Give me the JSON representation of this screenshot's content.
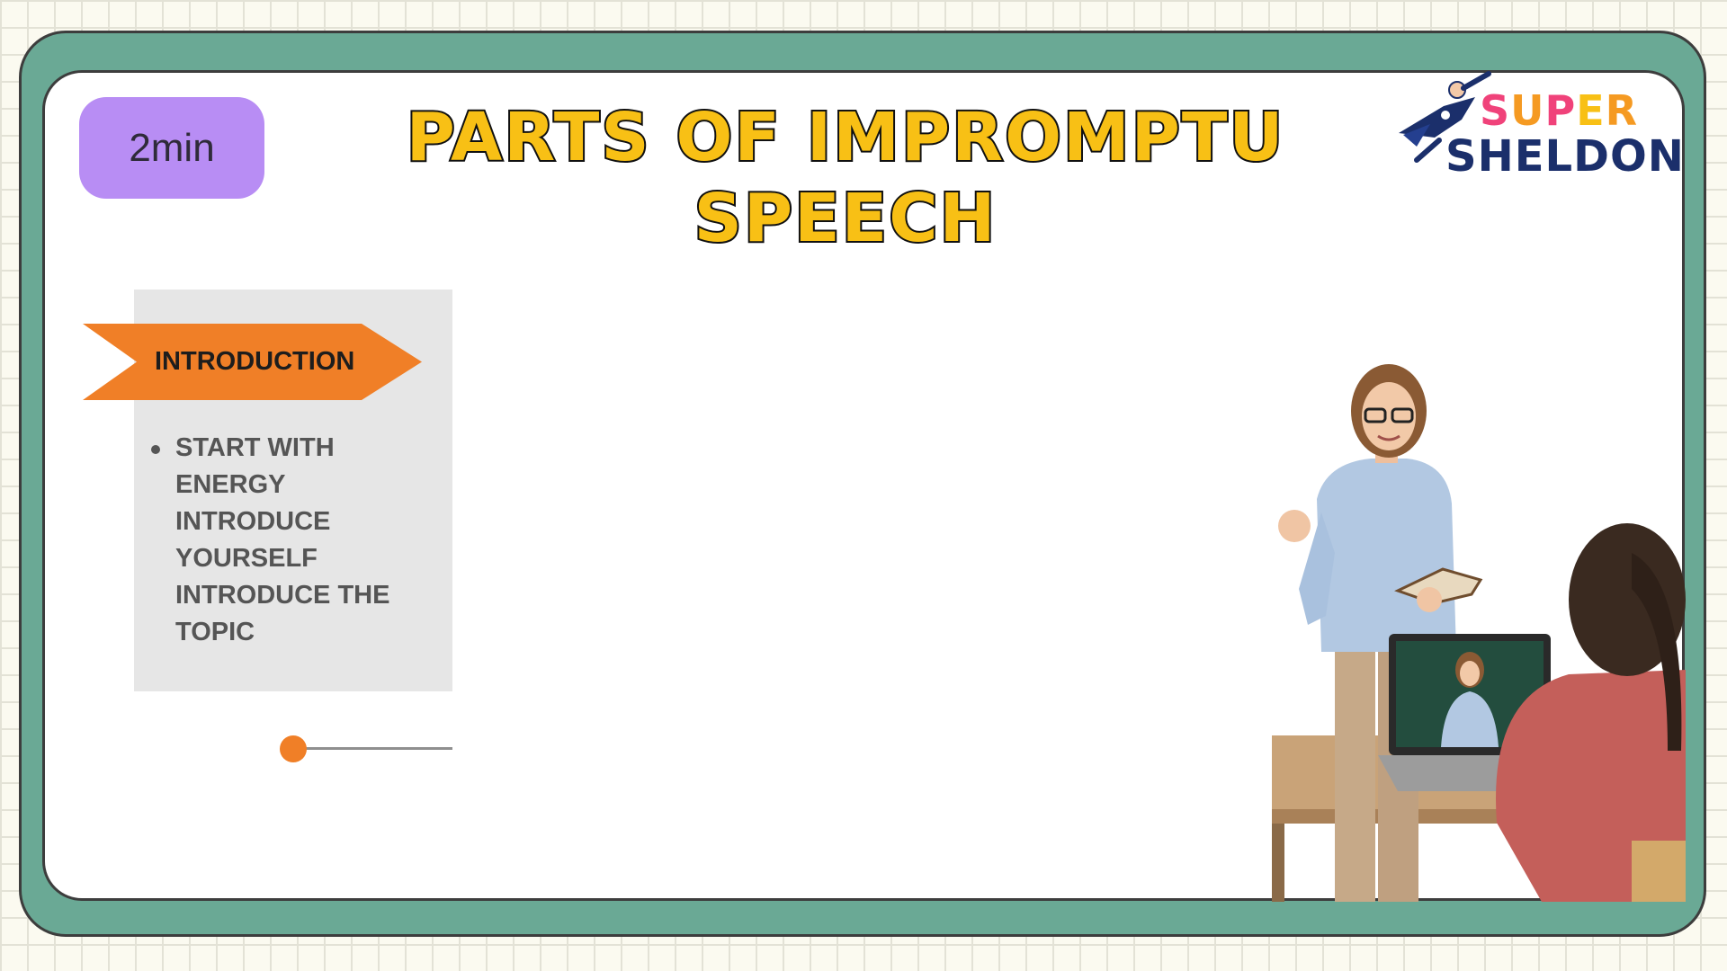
{
  "timer": {
    "label": "2min"
  },
  "title": {
    "line1": "PARTS OF IMPROMPTU",
    "line2": "SPEECH"
  },
  "logo": {
    "super": "SUPER",
    "sheldon": "SHELDON"
  },
  "section": {
    "label": "INTRODUCTION",
    "bullets": [
      "START WITH",
      "ENERGY",
      "INTRODUCE",
      "YOURSELF",
      "INTRODUCE THE",
      "TOPIC"
    ]
  },
  "progress": {
    "value": 0
  },
  "colors": {
    "frame": "#6aa995",
    "title": "#f8c015",
    "timer_bg": "#b88df4",
    "arrow": "#f07f27",
    "panel": "#e6e6e6"
  }
}
